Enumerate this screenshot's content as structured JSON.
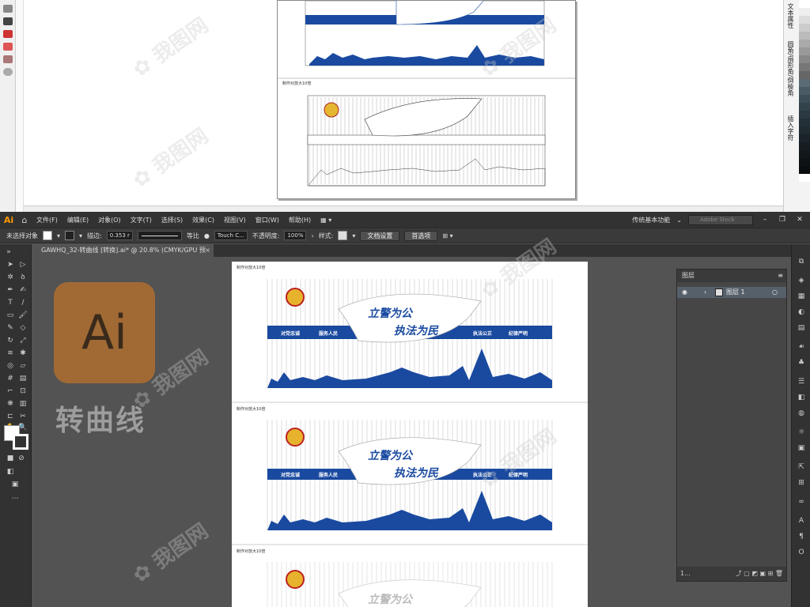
{
  "top_window": {
    "right_panel_tabs": [
      "文本属性",
      "圆角/扇形角/倒棱角",
      "插入字符"
    ],
    "page_label": "制作对放大10倍"
  },
  "menubar": {
    "logo": "Ai",
    "items": [
      "文件(F)",
      "编辑(E)",
      "对象(O)",
      "文字(T)",
      "选择(S)",
      "效果(C)",
      "视图(V)",
      "窗口(W)",
      "帮助(H)"
    ],
    "workspace": "传统基本功能",
    "search_placeholder": "Adobe Stock"
  },
  "controlbar": {
    "selection_label": "未选择对象",
    "stroke_label": "描边:",
    "stroke_value": "0.353 r",
    "stroke_profile": "等比",
    "brush": "Touch C...",
    "opacity_label": "不透明度:",
    "opacity_value": "100%",
    "style_label": "样式:",
    "doc_setup": "文档设置",
    "preferences": "首选项"
  },
  "document_tab": {
    "title": "GAWHQ_32-转曲线 [转换].ai* @ 20.8% (CMYK/GPU 预览)",
    "close": "×"
  },
  "overlay": {
    "badge_text": "Ai",
    "caption": "转曲线"
  },
  "artboard": {
    "section_labels": [
      "制作对放大10倍",
      "制作对放大10倍",
      "制作对放大10倍"
    ],
    "banner": {
      "title_line1": "立警为公",
      "title_line2": "执法为民",
      "slogans": [
        "对党忠诚",
        "服务人民",
        "执法公正",
        "纪律严明"
      ]
    }
  },
  "layers_panel": {
    "title": "图层",
    "layer_name": "图层 1",
    "footer_count": "1..."
  },
  "colors": {
    "banner_blue": "#1a4aa0",
    "ai_badge": "#a16a34",
    "ui_dark": "#323232",
    "ui_mid": "#535353"
  }
}
